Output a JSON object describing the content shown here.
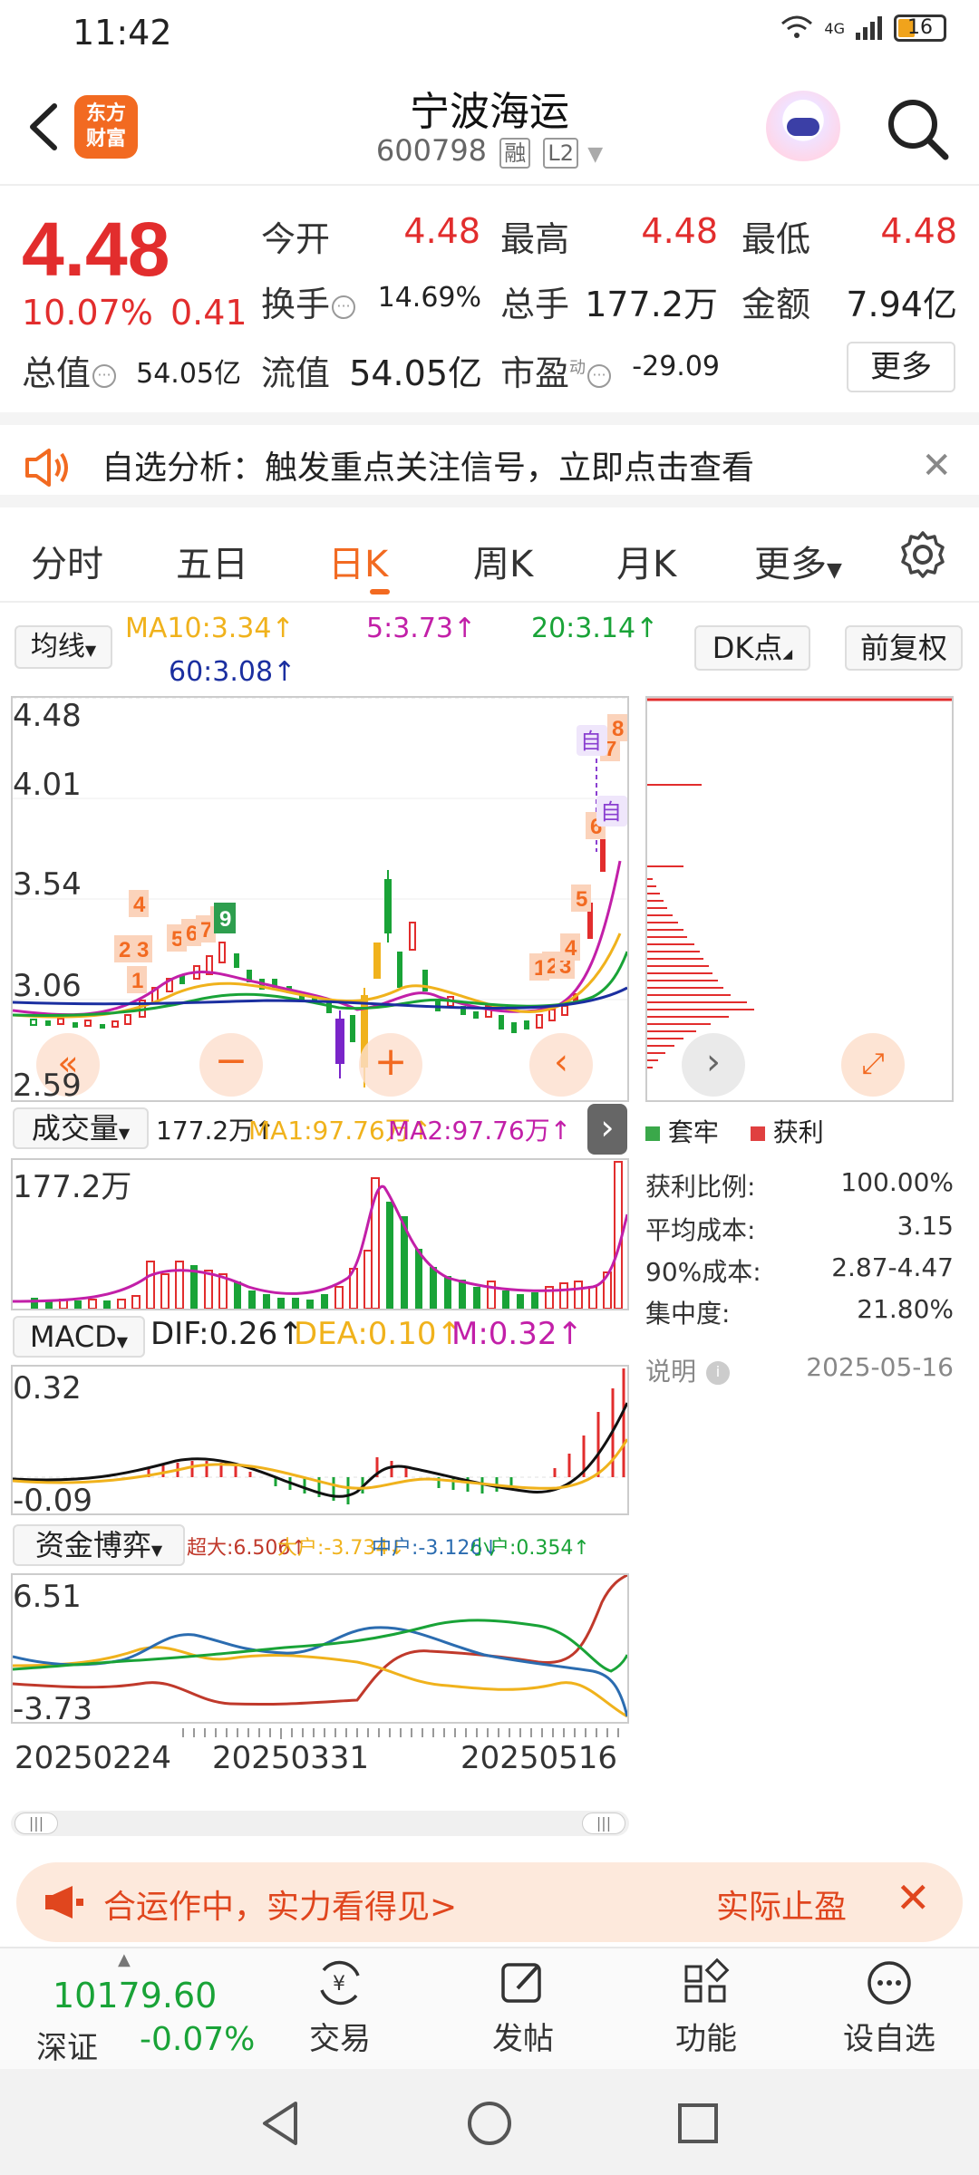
{
  "status_bar": {
    "time": "11:42",
    "network": "4G",
    "battery": "16"
  },
  "header": {
    "title": "宁波海运",
    "code": "600798",
    "tag_margin": "融",
    "tag_level": "L2"
  },
  "quote": {
    "price": "4.48",
    "pct": "10.07%",
    "change": "0.41",
    "open_label": "今开",
    "open": "4.48",
    "high_label": "最高",
    "high": "4.48",
    "low_label": "最低",
    "low": "4.48",
    "turnover_label": "换手",
    "turnover": "14.69%",
    "volume_label": "总手",
    "volume": "177.2万",
    "amount_label": "金额",
    "amount": "7.94亿",
    "mktcap_label": "总值",
    "mktcap": "54.05亿",
    "float_label": "流值",
    "float": "54.05亿",
    "pe_label": "市盈",
    "pe_sup": "动",
    "pe": "-29.09",
    "more": "更多"
  },
  "notice": {
    "text": "自选分析：触发重点关注信号，立即点击查看"
  },
  "tabs": [
    "分时",
    "五日",
    "日K",
    "周K",
    "月K",
    "更多"
  ],
  "ma_legend": {
    "selector": "均线",
    "ma10": "MA10:3.34",
    "ma5": "5:3.73",
    "ma20": "20:3.14",
    "ma60": "60:3.08",
    "dk_button": "DK点",
    "adjust_button": "前复权"
  },
  "kline_axis": [
    "4.48",
    "4.01",
    "3.54",
    "3.06",
    "2.59"
  ],
  "volume_pane": {
    "selector": "成交量",
    "val": "177.2万",
    "ma1": "MA1:97.76万",
    "ma2": "MA2:97.76万",
    "axis_top": "177.2万"
  },
  "macd_pane": {
    "selector": "MACD",
    "dif": "DIF:0.26",
    "dea": "DEA:0.10",
    "m": "M:0.32",
    "axis_top": "0.32",
    "axis_bottom": "-0.09"
  },
  "fund_pane": {
    "selector": "资金博弈",
    "super": "超大:6.506",
    "big": "大户:-3.734",
    "mid": "中户:-3.126",
    "small": "小户:0.354",
    "axis_top": "6.51",
    "axis_bottom": "-3.73"
  },
  "dates": [
    "20250224",
    "20250331",
    "20250516"
  ],
  "chip_panel": {
    "legend_trapped": "套牢",
    "legend_profit": "获利",
    "rows": [
      {
        "label": "获利比例:",
        "value": "100.00%"
      },
      {
        "label": "平均成本:",
        "value": "3.15"
      },
      {
        "label": "90%成本:",
        "value": "2.87-4.47"
      },
      {
        "label": "集中度:",
        "value": "21.80%"
      }
    ],
    "note_label": "说明",
    "date": "2025-05-16"
  },
  "promo": {
    "left": "合运作中，实力看得见>",
    "right": "实际止盈"
  },
  "bottom_bar": {
    "index_value": "10179.60",
    "index_name": "深证",
    "index_change": "-0.07%",
    "nav": [
      "交易",
      "发帖",
      "功能",
      "设自选"
    ]
  },
  "colors": {
    "up": "#e22d2d",
    "down": "#19a337",
    "accent": "#f26a21"
  }
}
